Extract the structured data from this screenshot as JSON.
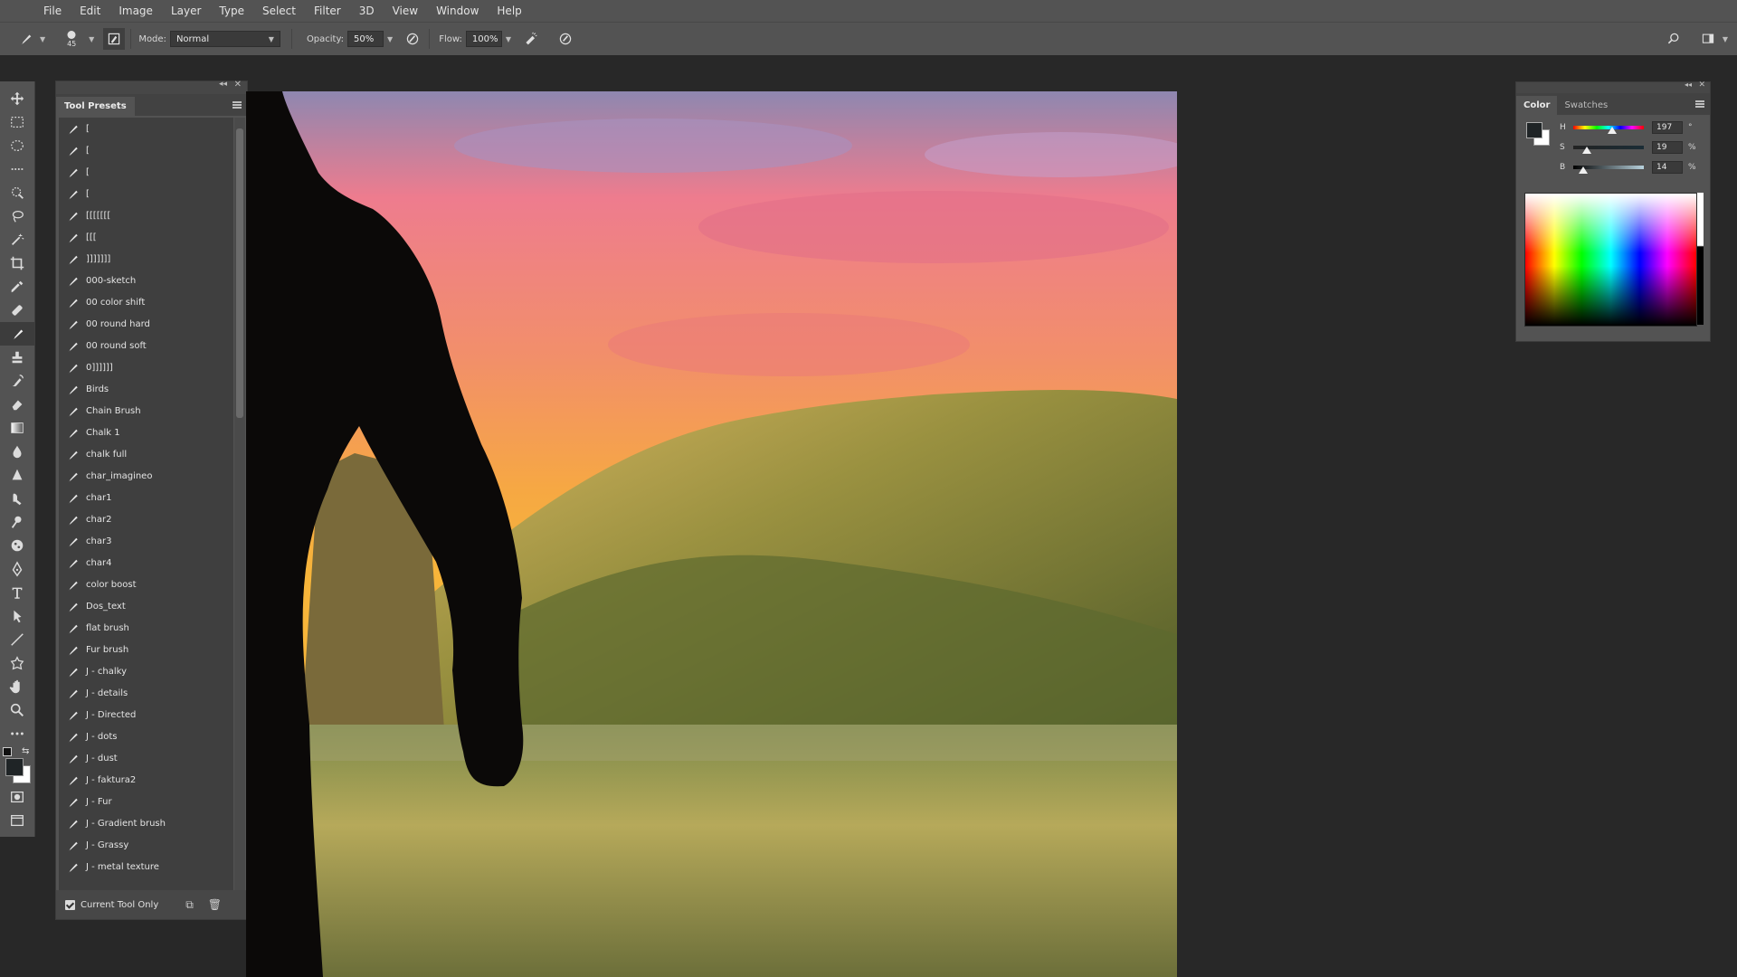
{
  "menu": [
    "File",
    "Edit",
    "Image",
    "Layer",
    "Type",
    "Select",
    "Filter",
    "3D",
    "View",
    "Window",
    "Help"
  ],
  "options_bar": {
    "brush_size": "45",
    "mode_label": "Mode:",
    "mode_value": "Normal",
    "opacity_label": "Opacity:",
    "opacity_value": "50%",
    "flow_label": "Flow:",
    "flow_value": "100%"
  },
  "tool_presets": {
    "title": "Tool Presets",
    "items": [
      "[",
      "[",
      "[",
      "[",
      "[[[[[[[",
      "[[[",
      "]]]]]]]",
      "000-sketch",
      "00 color shift",
      "00 round hard",
      "00 round soft",
      "0]]]]]]",
      "Birds",
      "Chain Brush",
      "Chalk 1",
      "chalk full",
      "char_imagineo",
      "char1",
      "char2",
      "char3",
      "char4",
      "color boost",
      "Dos_text",
      "flat brush",
      "Fur brush",
      "J - chalky",
      "J - details",
      "J - Directed",
      "J - dots",
      "J - dust",
      "J - faktura2",
      "J - Fur",
      "J - Gradient brush",
      "J - Grassy",
      "J - metal texture"
    ],
    "current_tool_only_label": "Current Tool Only",
    "current_tool_only_checked": true
  },
  "color_panel": {
    "tabs": [
      "Color",
      "Swatches"
    ],
    "hsb": [
      {
        "label": "H",
        "value": "197",
        "unit": "°",
        "fraction": 0.55
      },
      {
        "label": "S",
        "value": "19",
        "unit": "%",
        "fraction": 0.19
      },
      {
        "label": "B",
        "value": "14",
        "unit": "%",
        "fraction": 0.14
      }
    ],
    "foreground_color": "#1f2426",
    "background_color": "#ffffff"
  }
}
